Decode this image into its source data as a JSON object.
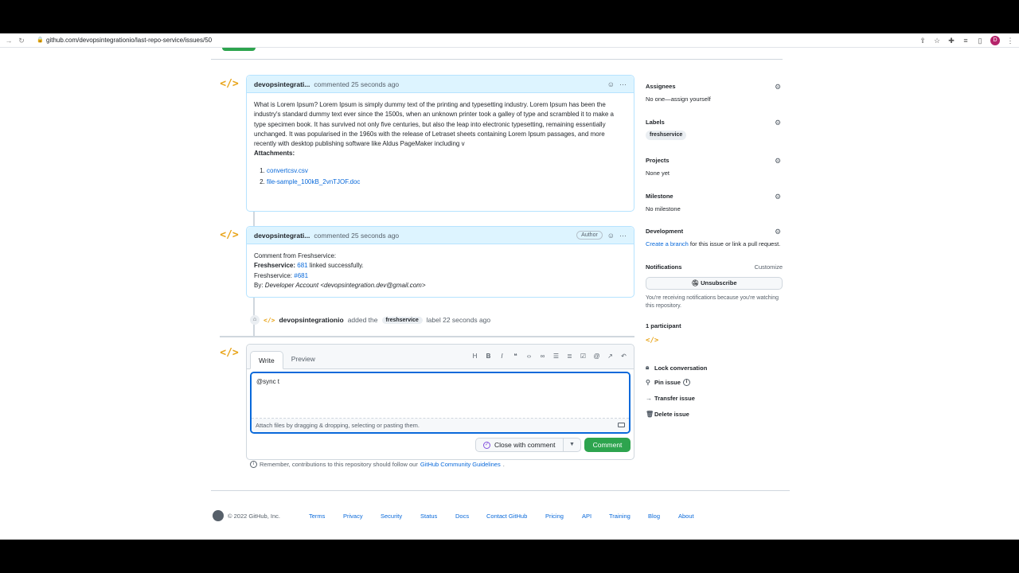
{
  "browser": {
    "url": "github.com/devopsintegrationio/last-repo-service/issues/50",
    "profile_initial": "D"
  },
  "comments": [
    {
      "author": "devopsintegrati...",
      "time": "commented 25 seconds ago",
      "body": "What is Lorem Ipsum? Lorem Ipsum is simply dummy text of the printing and typesetting industry. Lorem Ipsum has been the industry's standard dummy text ever since the 1500s, when an unknown printer took a galley of type and scrambled it to make a type specimen book. It has survived not only five centuries, but also the leap into electronic typesetting, remaining essentially unchanged. It was popularised in the 1960s with the release of Letraset sheets containing Lorem Ipsum passages, and more recently with desktop publishing software like Aldus PageMaker including v",
      "attachments_title": "Attachments:",
      "attachments": [
        "convertcsv.csv",
        "file-sample_100kB_2vnTJOF.doc"
      ]
    },
    {
      "author": "devopsintegrati...",
      "time": "commented 25 seconds ago",
      "badge": "Author",
      "line1": "Comment from Freshservice:",
      "line2_bold": "Freshservice:",
      "line2_link": "681",
      "line2_rest": " linked successfully.",
      "line3_label": "Freshservice:",
      "line3_link": "#681",
      "line4_label": "By:",
      "line4_italic": "Developer Account <devopsintegration.dev@gmail.com>"
    }
  ],
  "event": {
    "actor": "devopsintegrationio",
    "text1": "added the",
    "label": "freshservice",
    "text2": "label 22 seconds ago"
  },
  "editor": {
    "tab_write": "Write",
    "tab_preview": "Preview",
    "value": "@sync t",
    "attach_hint": "Attach files by dragging & dropping, selecting or pasting them.",
    "close_label": "Close with comment",
    "comment_label": "Comment"
  },
  "remember": {
    "text": "Remember, contributions to this repository should follow our",
    "link": "GitHub Community Guidelines",
    "end": "."
  },
  "sidebar": {
    "assignees_title": "Assignees",
    "assignees_value": "No one—",
    "assignees_link": "assign yourself",
    "labels_title": "Labels",
    "labels_value": "freshservice",
    "projects_title": "Projects",
    "projects_value": "None yet",
    "milestone_title": "Milestone",
    "milestone_value": "No milestone",
    "development_title": "Development",
    "development_link": "Create a branch",
    "development_rest": " for this issue or link a pull request.",
    "notifications_title": "Notifications",
    "notifications_customize": "Customize",
    "unsubscribe": "Unsubscribe",
    "notifications_note": "You're receiving notifications because you're watching this repository.",
    "participants_title": "1 participant",
    "lock": "Lock conversation",
    "pin": "Pin issue",
    "transfer": "Transfer issue",
    "delete": "Delete issue"
  },
  "footer": {
    "copyright": "© 2022 GitHub, Inc.",
    "links": [
      "Terms",
      "Privacy",
      "Security",
      "Status",
      "Docs",
      "Contact GitHub",
      "Pricing",
      "API",
      "Training",
      "Blog",
      "About"
    ]
  }
}
